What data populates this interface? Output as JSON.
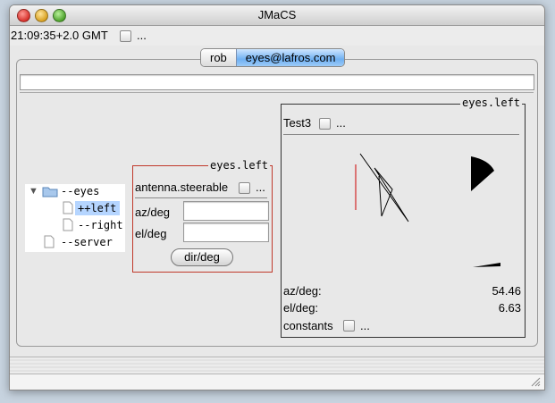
{
  "window": {
    "title": "JMaCS"
  },
  "toolbar": {
    "time": "21:09:35+2.0 GMT",
    "more": "..."
  },
  "tabs": [
    {
      "label": "rob"
    },
    {
      "label": "eyes@lafros.com"
    }
  ],
  "tree": {
    "root": "--eyes",
    "children": [
      {
        "label": "++left"
      },
      {
        "label": "--right"
      }
    ],
    "server": "--server"
  },
  "control_panel": {
    "title": "eyes.left",
    "steerable_label": "antenna.steerable",
    "more": "...",
    "az_label": "az/deg",
    "el_label": "el/deg",
    "az_value": "",
    "el_value": "",
    "button_label": "dir/deg"
  },
  "display_panel": {
    "title": "eyes.left",
    "test_label": "Test3",
    "more": "...",
    "az_label": "az/deg:",
    "az_value": "54.46",
    "el_label": "el/deg:",
    "el_value": "6.63",
    "constants_label": "constants",
    "constants_more": "..."
  }
}
